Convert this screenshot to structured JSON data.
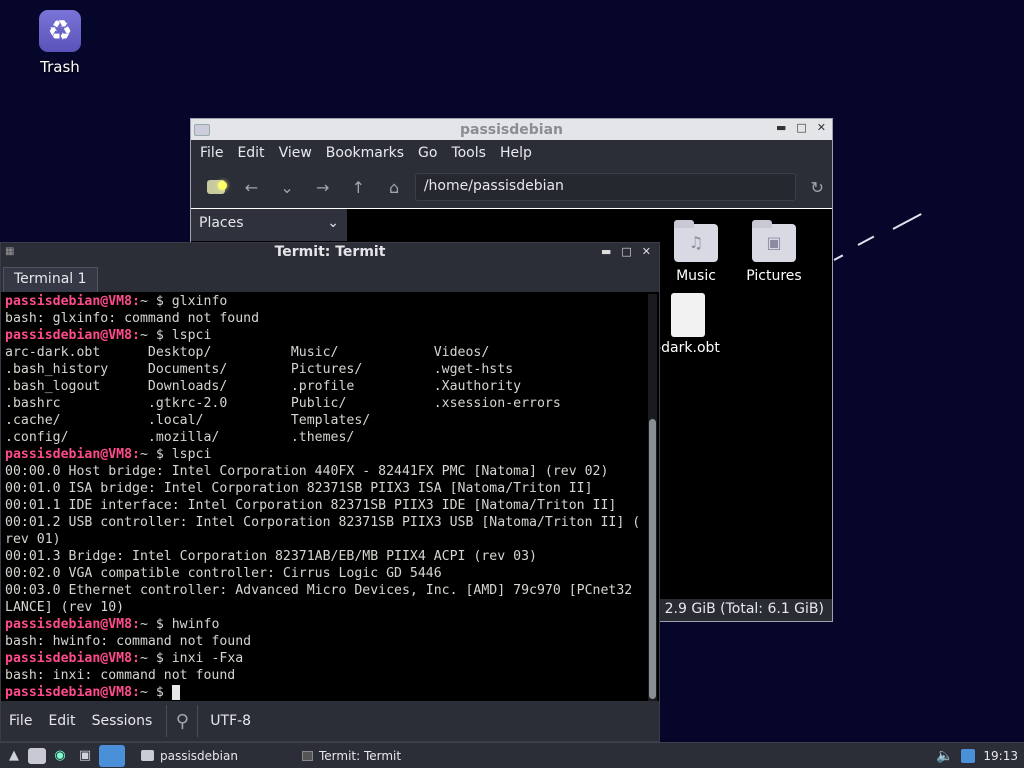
{
  "desktop": {
    "trash_label": "Trash"
  },
  "file_manager": {
    "title": "passisdebian",
    "menu": [
      "File",
      "Edit",
      "View",
      "Bookmarks",
      "Go",
      "Tools",
      "Help"
    ],
    "address": "/home/passisdebian",
    "places_label": "Places",
    "items": [
      {
        "label": "Music",
        "icon": "music-folder-icon"
      },
      {
        "label": "Pictures",
        "icon": "pictures-folder-icon"
      },
      {
        "label": "-dark.obt",
        "icon": "text-file-icon"
      }
    ],
    "status": ": 2.9 GiB (Total: 6.1 GiB)"
  },
  "terminal": {
    "title": "Termit: Termit",
    "tab": "Terminal 1",
    "prompt": "passisdebian@VM8:",
    "lines": [
      {
        "p": "passisdebian@VM8:",
        "t": "~ $ glxinfo"
      },
      {
        "p": "",
        "t": "bash: glxinfo: command not found"
      },
      {
        "p": "passisdebian@VM8:",
        "t": "~ $ lspci"
      },
      {
        "p": "",
        "t": "arc-dark.obt      Desktop/          Music/            Videos/"
      },
      {
        "p": "",
        "t": ".bash_history     Documents/        Pictures/         .wget-hsts"
      },
      {
        "p": "",
        "t": ".bash_logout      Downloads/        .profile          .Xauthority"
      },
      {
        "p": "",
        "t": ".bashrc           .gtkrc-2.0        Public/           .xsession-errors"
      },
      {
        "p": "",
        "t": ".cache/           .local/           Templates/"
      },
      {
        "p": "",
        "t": ".config/          .mozilla/         .themes/"
      },
      {
        "p": "passisdebian@VM8:",
        "t": "~ $ lspci"
      },
      {
        "p": "",
        "t": "00:00.0 Host bridge: Intel Corporation 440FX - 82441FX PMC [Natoma] (rev 02)"
      },
      {
        "p": "",
        "t": "00:01.0 ISA bridge: Intel Corporation 82371SB PIIX3 ISA [Natoma/Triton II]"
      },
      {
        "p": "",
        "t": "00:01.1 IDE interface: Intel Corporation 82371SB PIIX3 IDE [Natoma/Triton II]"
      },
      {
        "p": "",
        "t": "00:01.2 USB controller: Intel Corporation 82371SB PIIX3 USB [Natoma/Triton II] ("
      },
      {
        "p": "",
        "t": "rev 01)"
      },
      {
        "p": "",
        "t": "00:01.3 Bridge: Intel Corporation 82371AB/EB/MB PIIX4 ACPI (rev 03)"
      },
      {
        "p": "",
        "t": "00:02.0 VGA compatible controller: Cirrus Logic GD 5446"
      },
      {
        "p": "",
        "t": "00:03.0 Ethernet controller: Advanced Micro Devices, Inc. [AMD] 79c970 [PCnet32"
      },
      {
        "p": "",
        "t": "LANCE] (rev 10)"
      },
      {
        "p": "passisdebian@VM8:",
        "t": "~ $ hwinfo"
      },
      {
        "p": "",
        "t": "bash: hwinfo: command not found"
      },
      {
        "p": "passisdebian@VM8:",
        "t": "~ $ inxi -Fxa"
      },
      {
        "p": "",
        "t": "bash: inxi: command not found"
      },
      {
        "p": "passisdebian@VM8:",
        "t": "~ $ ",
        "cursor": true
      }
    ],
    "menu": [
      "File",
      "Edit",
      "Sessions"
    ],
    "encoding": "UTF-8"
  },
  "taskbar": {
    "tasks": [
      "passisdebian",
      "Termit: Termit"
    ],
    "clock": "19:13"
  }
}
